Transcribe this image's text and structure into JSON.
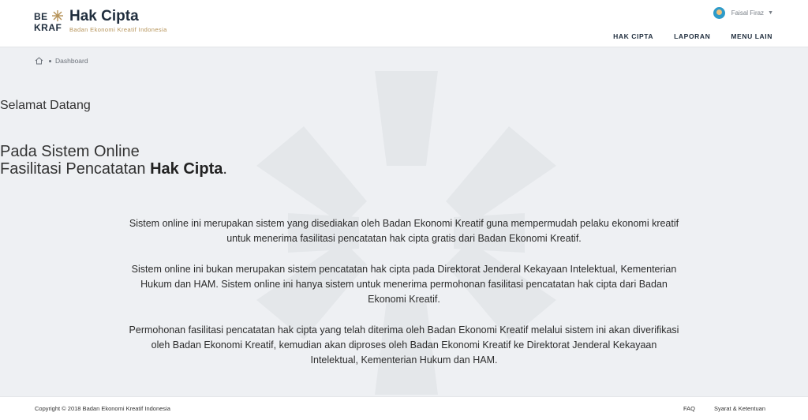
{
  "header": {
    "logo_line1": "BE",
    "logo_line2": "KRAF",
    "title": "Hak Cipta",
    "subtitle": "Badan Ekonomi Kreatif Indonesia",
    "user_name": "Faisal Firaz",
    "nav": [
      {
        "label": "HAK CIPTA"
      },
      {
        "label": "LAPORAN"
      },
      {
        "label": "MENU LAIN"
      }
    ]
  },
  "breadcrumb": {
    "current": "Dashboard"
  },
  "main": {
    "welcome": "Selamat Datang",
    "headline_line1": "Pada Sistem Online",
    "headline_line2_prefix": "Fasilitasi Pencatatan ",
    "headline_line2_bold": "Hak Cipta",
    "headline_line2_suffix": ".",
    "paragraphs": [
      "Sistem online ini merupakan sistem yang disediakan oleh Badan Ekonomi Kreatif guna mempermudah pelaku ekonomi kreatif untuk menerima fasilitasi pencatatan hak cipta gratis dari Badan Ekonomi Kreatif.",
      "Sistem online ini bukan merupakan sistem pencatatan hak cipta pada Direktorat Jenderal Kekayaan Intelektual, Kementerian Hukum dan HAM. Sistem online ini hanya sistem untuk menerima permohonan fasilitasi pencatatan hak cipta dari Badan Ekonomi Kreatif.",
      "Permohonan fasilitasi pencatatan hak cipta yang telah diterima oleh Badan Ekonomi Kreatif melalui sistem ini akan diverifikasi oleh Badan Ekonomi Kreatif, kemudian akan diproses oleh Badan Ekonomi Kreatif ke Direktorat Jenderal Kekayaan Intelektual, Kementerian Hukum dan HAM."
    ]
  },
  "footer": {
    "copyright": "Copyright © 2018 Badan Ekonomi Kreatif Indonesia",
    "links": [
      {
        "label": "FAQ"
      },
      {
        "label": "Syarat & Ketentuan"
      }
    ]
  },
  "colors": {
    "brand_navy": "#1f2d3d",
    "brand_gold": "#b59257",
    "page_bg": "#eef0f3"
  }
}
